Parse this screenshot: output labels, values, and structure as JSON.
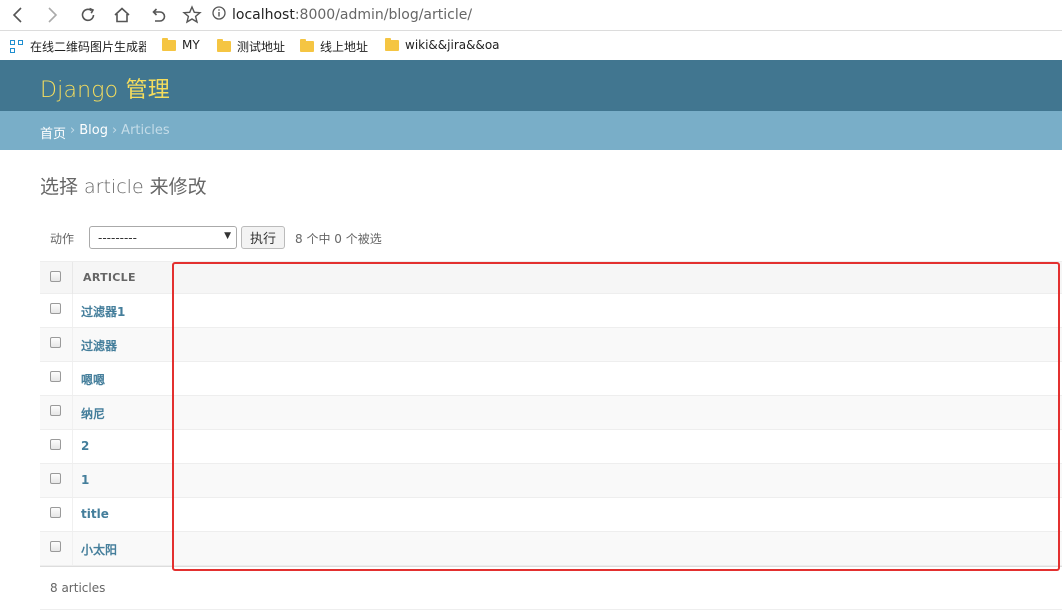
{
  "browser": {
    "url_host": "localhost",
    "url_path": ":8000/admin/blog/article/",
    "nav_icons": [
      "back-icon",
      "forward-icon",
      "reload-icon",
      "home-icon",
      "undo-icon",
      "star-icon"
    ],
    "bookmarks": [
      {
        "label": "在线二维码图片生成器",
        "icon": "qr-code-icon"
      },
      {
        "label": "MY",
        "icon": "folder-icon"
      },
      {
        "label": "测试地址",
        "icon": "folder-icon"
      },
      {
        "label": "线上地址",
        "icon": "folder-icon"
      },
      {
        "label": "wiki&&jira&&oa",
        "icon": "folder-icon"
      }
    ]
  },
  "header": {
    "branding": "Django 管理"
  },
  "breadcrumbs": {
    "home": "首页",
    "sep": "›",
    "app": "Blog",
    "current": "Articles"
  },
  "page": {
    "title": "选择 article 来修改"
  },
  "actions": {
    "label": "动作",
    "selected": "---------",
    "go_button": "执行",
    "counter": "8 个中 0 个被选"
  },
  "table": {
    "column_header": "ARTICLE",
    "rows": [
      "过滤器1",
      "过滤器",
      "嗯嗯",
      "纳尼",
      "2",
      "1",
      "title",
      "小太阳"
    ]
  },
  "paginator": {
    "text": "8 articles"
  },
  "colors": {
    "header_bg": "#417690",
    "branding": "#f5dd5d",
    "breadcrumbs_bg": "#79aec8",
    "link": "#447e9b",
    "annotation": "#e3302f"
  }
}
